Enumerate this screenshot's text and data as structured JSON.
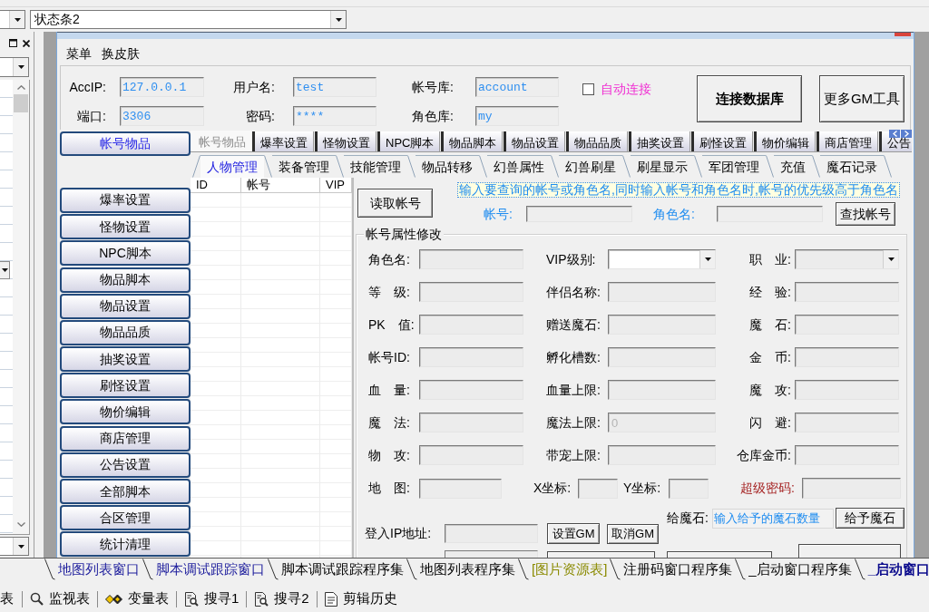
{
  "toolbar": {
    "combo_value": "状态条2"
  },
  "app_window": {
    "menu": [
      "菜单",
      "换皮肤"
    ],
    "connection": {
      "rows": [
        [
          {
            "label": "AccIP:",
            "value": "127.0.0.1"
          },
          {
            "label": "用户名:",
            "value": "test"
          },
          {
            "label": "帐号库:",
            "value": "account"
          }
        ],
        [
          {
            "label": "端口:",
            "value": "3306"
          },
          {
            "label": "密码:",
            "value": "****"
          },
          {
            "label": "角色库:",
            "value": "my"
          }
        ]
      ],
      "auto_connect": {
        "label": "自动连接",
        "checked": false
      },
      "buttons": [
        {
          "label": "连接数据库",
          "kind": "primary"
        },
        {
          "label": "更多GM工具",
          "kind": "normal"
        }
      ]
    },
    "side_buttons": [
      {
        "label": "帐号物品",
        "selected": true
      },
      {
        "label": "爆率设置",
        "selected": false
      },
      {
        "label": "怪物设置",
        "selected": false
      },
      {
        "label": "NPC脚本",
        "selected": false
      },
      {
        "label": "物品脚本",
        "selected": false
      },
      {
        "label": "物品设置",
        "selected": false
      },
      {
        "label": "物品品质",
        "selected": false
      },
      {
        "label": "抽奖设置",
        "selected": false
      },
      {
        "label": "刷怪设置",
        "selected": false
      },
      {
        "label": "物价编辑",
        "selected": false
      },
      {
        "label": "商店管理",
        "selected": false
      },
      {
        "label": "公告设置",
        "selected": false
      },
      {
        "label": "全部脚本",
        "selected": false
      },
      {
        "label": "合区管理",
        "selected": false
      },
      {
        "label": "统计清理",
        "selected": false
      }
    ],
    "tabs": [
      {
        "label": "帐号物品",
        "selected": true
      },
      {
        "label": "爆率设置",
        "selected": false
      },
      {
        "label": "怪物设置",
        "selected": false
      },
      {
        "label": "NPC脚本",
        "selected": false
      },
      {
        "label": "物品脚本",
        "selected": false
      },
      {
        "label": "物品设置",
        "selected": false
      },
      {
        "label": "物品品质",
        "selected": false
      },
      {
        "label": "抽奖设置",
        "selected": false
      },
      {
        "label": "刷怪设置",
        "selected": false
      },
      {
        "label": "物价编辑",
        "selected": false
      },
      {
        "label": "商店管理",
        "selected": false
      },
      {
        "label": "公告",
        "selected": false
      }
    ],
    "subtabs": [
      {
        "label": "人物管理",
        "selected": true
      },
      {
        "label": "装备管理",
        "selected": false
      },
      {
        "label": "技能管理",
        "selected": false
      },
      {
        "label": "物品转移",
        "selected": false
      },
      {
        "label": "幻兽属性",
        "selected": false
      },
      {
        "label": "幻兽刷星",
        "selected": false
      },
      {
        "label": "刷星显示",
        "selected": false
      },
      {
        "label": "军团管理",
        "selected": false
      },
      {
        "label": "充值",
        "selected": false
      },
      {
        "label": "魔石记录",
        "selected": false
      }
    ],
    "account_table": {
      "columns": [
        "ID",
        "帐号",
        "VIP"
      ]
    },
    "lookup": {
      "read_button": "读取帐号",
      "hint": "输入要查询的帐号或角色名,同时输入帐号和角色名时,帐号的优先级高于角色名",
      "fields": [
        {
          "label": "帐号:"
        },
        {
          "label": "角色名:"
        }
      ],
      "find_button": "查找帐号"
    },
    "attributes": {
      "title": "帐号属性修改",
      "grid": [
        [
          {
            "label": "角色名:",
            "kind": "text"
          },
          {
            "label": "VIP级别:",
            "kind": "select",
            "disabled": false
          },
          {
            "label": "职　业:",
            "kind": "select",
            "disabled": true
          }
        ],
        [
          {
            "label": "等　级:",
            "kind": "text"
          },
          {
            "label": "伴侣名称:",
            "kind": "text"
          },
          {
            "label": "经　验:",
            "kind": "text"
          }
        ],
        [
          {
            "label": "PK　值:",
            "kind": "text"
          },
          {
            "label": "赠送魔石:",
            "kind": "text"
          },
          {
            "label": "魔　石:",
            "kind": "text"
          }
        ],
        [
          {
            "label": "帐号ID:",
            "kind": "text"
          },
          {
            "label": "孵化槽数:",
            "kind": "text"
          },
          {
            "label": "金　币:",
            "kind": "text"
          }
        ],
        [
          {
            "label": "血　量:",
            "kind": "text"
          },
          {
            "label": "血量上限:",
            "kind": "text"
          },
          {
            "label": "魔　攻:",
            "kind": "text"
          }
        ],
        [
          {
            "label": "魔　法:",
            "kind": "text"
          },
          {
            "label": "魔法上限:",
            "kind": "text",
            "value": "0"
          },
          {
            "label": "闪　避:",
            "kind": "text"
          }
        ],
        [
          {
            "label": "物　攻:",
            "kind": "text"
          },
          {
            "label": "带宠上限:",
            "kind": "text"
          },
          {
            "label": "仓库金币:",
            "kind": "text"
          }
        ]
      ],
      "position_row": [
        {
          "label": "地　图:",
          "kind": "map"
        },
        {
          "label": "X坐标:",
          "kind": "coord"
        },
        {
          "label": "Y坐标:",
          "kind": "coord"
        },
        {
          "label": "超级密码:",
          "kind": "secure"
        }
      ],
      "gift": {
        "label": "给魔石:",
        "placeholder": "输入给予的魔石数量",
        "button": "给予魔石"
      },
      "login_ip": {
        "label": "登入IP地址:",
        "buttons": [
          "设置GM",
          "取消GM"
        ]
      }
    }
  },
  "ide_tabs": [
    {
      "label": "地图列表窗口",
      "color": "#1c1c9c",
      "selected": false
    },
    {
      "label": "脚本调试跟踪窗口",
      "color": "#1c1c9c",
      "selected": false
    },
    {
      "label": "脚本调试跟踪程序集",
      "color": "#000000",
      "selected": false
    },
    {
      "label": "地图列表程序集",
      "color": "#000000",
      "selected": false
    },
    {
      "label": "[图片资源表]",
      "color": "#8a8a00",
      "selected": false
    },
    {
      "label": "注册码窗口程序集",
      "color": "#000000",
      "selected": false
    },
    {
      "label": "_启动窗口程序集",
      "color": "#000000",
      "selected": false
    },
    {
      "label": "_启动窗口",
      "color": "#0a0a8c",
      "selected": true
    }
  ],
  "bottom_toolbar": [
    {
      "label": "表",
      "kind": "plain"
    },
    {
      "label": "监视表",
      "kind": "watch"
    },
    {
      "label": "变量表",
      "kind": "variables"
    },
    {
      "label": "搜寻1",
      "kind": "find"
    },
    {
      "label": "搜寻2",
      "kind": "find"
    },
    {
      "label": "剪辑历史",
      "kind": "clipboard"
    }
  ]
}
